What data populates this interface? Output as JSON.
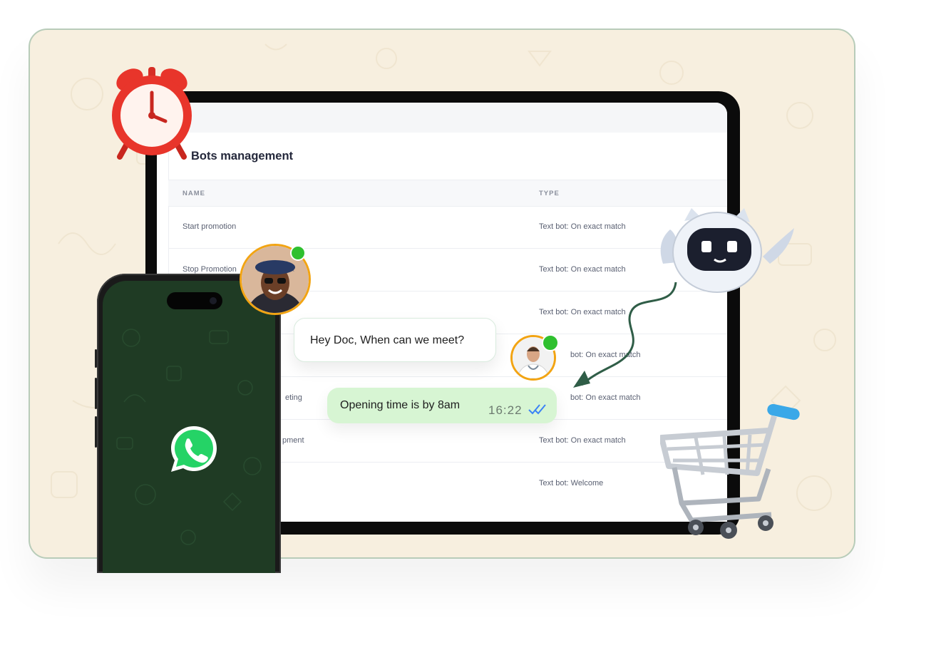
{
  "bots_panel": {
    "title": "Bots management",
    "columns": {
      "name": "NAME",
      "type": "TYPE"
    },
    "rows": [
      {
        "name": "Start promotion",
        "type": "Text bot: On exact match"
      },
      {
        "name": "Stop Promotion",
        "type": "Text bot: On exact match"
      },
      {
        "name": "",
        "type": "Text bot: On exact match"
      },
      {
        "name": "",
        "type": "bot: On exact match"
      },
      {
        "name": "eting",
        "type": "bot: On exact match"
      },
      {
        "name": "pment",
        "type": "Text bot: On exact match"
      },
      {
        "name": "",
        "type": "Text bot: Welcome"
      }
    ]
  },
  "chat": {
    "incoming_message": "Hey Doc, When can we meet?",
    "outgoing_message": "Opening time is by 8am",
    "outgoing_time": "16:22"
  },
  "icons": {
    "phone_app": "whatsapp-icon",
    "clock": "alarm-clock-icon",
    "robot": "robot-icon",
    "cart": "shopping-cart-icon",
    "read_receipt": "double-check-icon"
  },
  "colors": {
    "background": "#f7efdf",
    "whatsapp_green": "#25d366",
    "outgoing_bubble": "#d7f5d3",
    "online_dot": "#2fc02f",
    "avatar_ring": "#f2a413",
    "arrow": "#2f5d47"
  }
}
